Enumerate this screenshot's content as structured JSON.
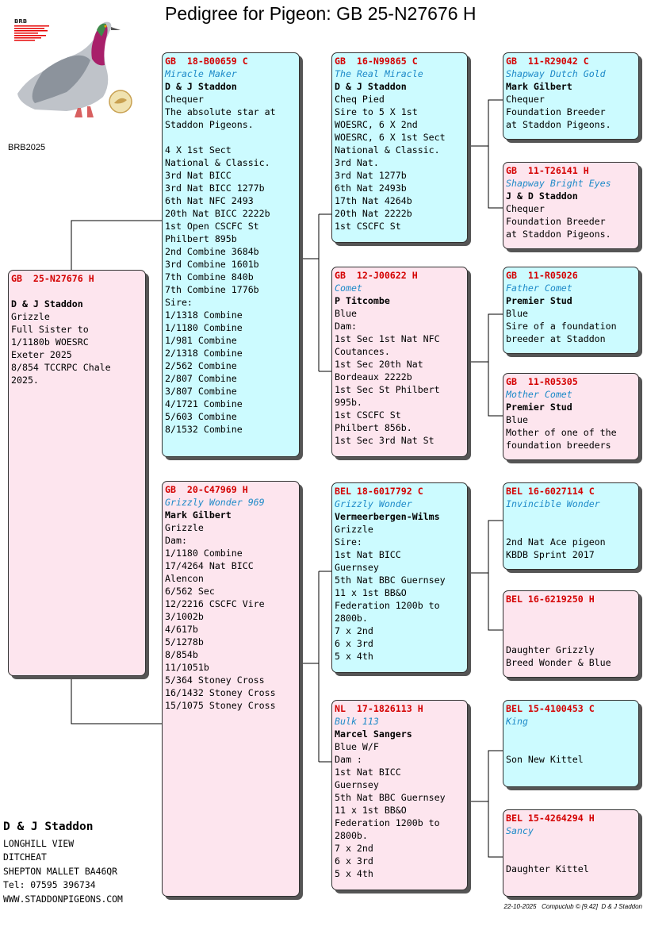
{
  "page": {
    "title": "Pedigree for Pigeon: GB  25-N27676 H",
    "ref": "BRB2025"
  },
  "logo": {
    "text": "BRB"
  },
  "owner": {
    "name": "D & J Staddon",
    "lines": [
      "LONGHILL VIEW",
      "DITCHEAT",
      "SHEPTON MALLET BA46QR",
      "Tel: 07595 396734",
      "WWW.STADDONPIGEONS.COM"
    ]
  },
  "footer": {
    "date": "22-10-2025",
    "app": "Compuclub © [9.42]",
    "owner": "D & J Staddon"
  },
  "cards": {
    "subject": {
      "ring": "GB  25-N27676 H",
      "name": "",
      "breeder": "D & J Staddon",
      "lines": [
        "Grizzle",
        "Full Sister to",
        "1/1180b WOESRC",
        "Exeter 2025",
        "8/854 TCCRPC Chale",
        "2025."
      ]
    },
    "sire": {
      "ring": "GB  18-B00659 C",
      "name": "Miracle Maker",
      "breeder": "D & J Staddon",
      "lines": [
        "Chequer",
        "The absolute star at",
        "Staddon Pigeons.",
        "",
        "4 X 1st Sect",
        "National & Classic.",
        "3rd Nat BICC",
        "3rd Nat BICC 1277b",
        "6th Nat NFC 2493",
        "20th Nat BICC 2222b",
        "1st Open CSCFC St",
        "Philbert 895b",
        "2nd Combine 3684b",
        "3rd Combine 1601b",
        "7th Combine 840b",
        "7th Combine 1776b",
        "Sire:",
        "1/1318 Combine",
        "1/1180 Combine",
        "1/981 Combine",
        "2/1318 Combine",
        "2/562 Combine",
        "2/807 Combine",
        "3/807 Combine",
        "4/1721 Combine",
        "5/603 Combine",
        "8/1532 Combine"
      ]
    },
    "dam": {
      "ring": "GB  20-C47969 H",
      "name": "Grizzly Wonder 969",
      "breeder": "Mark Gilbert",
      "lines": [
        "Grizzle",
        "Dam:",
        "1/1180 Combine",
        "17/4264 Nat BICC",
        "Alencon",
        "6/562 Sec",
        "12/2216 CSCFC Vire",
        "3/1002b",
        "4/617b",
        "5/1278b",
        "8/854b",
        "11/1051b",
        "5/364 Stoney Cross",
        "16/1432 Stoney Cross",
        "15/1075 Stoney Cross"
      ]
    },
    "ss": {
      "ring": "GB  16-N99865 C",
      "name": "The Real Miracle",
      "breeder": "D & J Staddon",
      "lines": [
        "Cheq Pied",
        "Sire to 5 X 1st",
        "WOESRC, 6 X 2nd",
        "WOESRC, 6 X 1st Sect",
        "National & Classic.",
        "3rd Nat.",
        "3rd Nat 1277b",
        "6th Nat 2493b",
        "17th Nat 4264b",
        "20th Nat 2222b",
        "1st CSCFC St"
      ]
    },
    "sd": {
      "ring": "GB  12-J00622 H",
      "name": "Comet",
      "breeder": "P Titcombe",
      "lines": [
        "Blue",
        "Dam:",
        "1st Sec 1st Nat NFC",
        "Coutances.",
        "1st Sec 20th Nat",
        "Bordeaux 2222b",
        "1st Sec St Philbert",
        "995b.",
        "1st CSCFC St",
        "Philbert 856b.",
        "1st Sec 3rd Nat St"
      ]
    },
    "ds": {
      "ring": "BEL 18-6017792 C",
      "name": "Grizzly Wonder",
      "breeder": "Vermeerbergen-Wilms",
      "lines": [
        "Grizzle",
        "Sire:",
        "1st Nat BICC",
        "Guernsey",
        "5th Nat BBC Guernsey",
        "11 x 1st BB&O",
        "Federation 1200b to",
        "2800b.",
        "7 x 2nd",
        "6 x 3rd",
        "5 x 4th"
      ]
    },
    "dd": {
      "ring": "NL  17-1826113 H",
      "name": "Bulk 113",
      "breeder": "Marcel Sangers",
      "lines": [
        "Blue W/F",
        "Dam :",
        "1st Nat BICC",
        "Guernsey",
        "5th Nat BBC Guernsey",
        "11 x 1st BB&O",
        "Federation 1200b to",
        "2800b.",
        "7 x 2nd",
        "6 x 3rd",
        "5 x 4th"
      ]
    },
    "sss": {
      "ring": "GB  11-R29042 C",
      "name": "Shapway Dutch Gold",
      "breeder": "Mark Gilbert",
      "lines": [
        "Chequer",
        "Foundation Breeder",
        "at Staddon Pigeons."
      ]
    },
    "ssd": {
      "ring": "GB  11-T26141 H",
      "name": "Shapway Bright Eyes",
      "breeder": "J & D Staddon",
      "lines": [
        "Chequer",
        "Foundation Breeder",
        "at Staddon Pigeons."
      ]
    },
    "sds": {
      "ring": "GB  11-R05026",
      "name": "Father Comet",
      "breeder": "Premier Stud",
      "lines": [
        "Blue",
        "Sire of a foundation",
        "breeder at Staddon"
      ]
    },
    "sdd": {
      "ring": "GB  11-R05305",
      "name": "Mother Comet",
      "breeder": "Premier Stud",
      "lines": [
        "Blue",
        "Mother of one of the",
        "foundation breeders"
      ]
    },
    "dss": {
      "ring": "BEL 16-6027114 C",
      "name": "Invincible Wonder",
      "breeder": "",
      "lines": [
        "",
        "2nd Nat Ace pigeon",
        "KBDB Sprint 2017"
      ]
    },
    "dsd": {
      "ring": "BEL 16-6219250 H",
      "name": "",
      "breeder": "",
      "lines": [
        "",
        "Daughter Grizzly",
        "Breed Wonder & Blue"
      ]
    },
    "dds": {
      "ring": "BEL 15-4100453 C",
      "name": "King",
      "breeder": "",
      "lines": [
        "",
        "Son New Kittel"
      ]
    },
    "ddd": {
      "ring": "BEL 15-4264294 H",
      "name": "Sancy",
      "breeder": "",
      "lines": [
        "",
        "Daughter Kittel"
      ]
    }
  }
}
